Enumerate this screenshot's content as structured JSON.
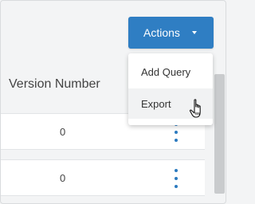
{
  "header": {
    "actions_button_label": "Actions"
  },
  "dropdown": {
    "items": [
      {
        "label": "Add Query"
      },
      {
        "label": "Export"
      }
    ]
  },
  "table": {
    "column_header": "Version Number",
    "rows": [
      {
        "version": "0"
      },
      {
        "version": "0"
      }
    ]
  },
  "colors": {
    "accent": "#2f7ec3",
    "kebab": "#2b7abf",
    "background": "#f3f4f5"
  },
  "icons": {
    "caret": "caret-down-icon",
    "row_menu": "kebab-menu-icon",
    "cursor": "hand-pointer-icon"
  }
}
